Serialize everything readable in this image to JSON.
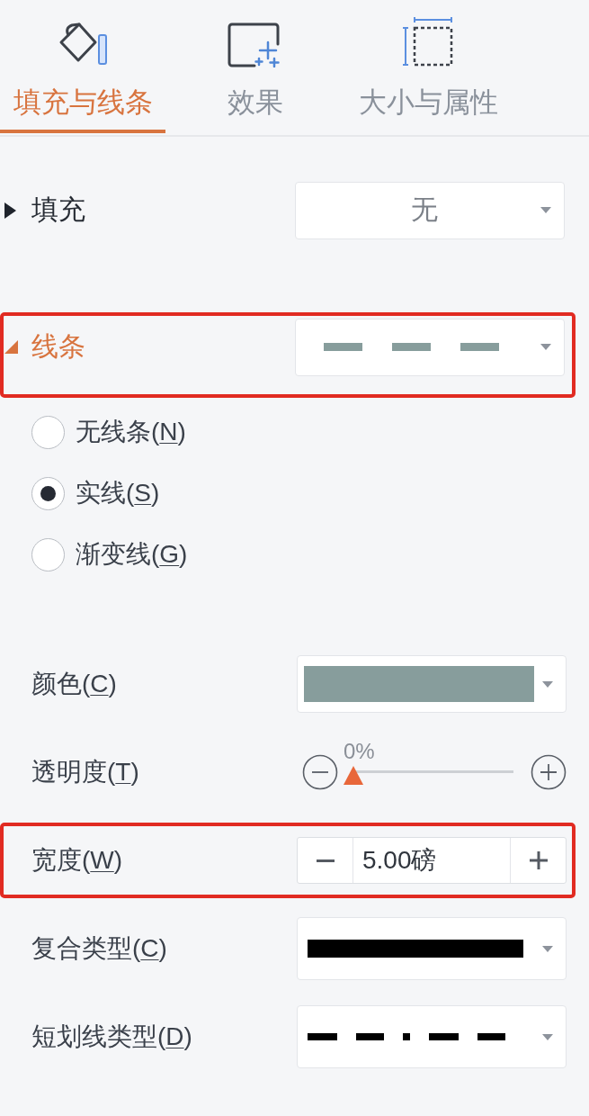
{
  "tabs": [
    {
      "label": "填充与线条",
      "selected": true
    },
    {
      "label": "效果",
      "selected": false
    },
    {
      "label": "大小与属性",
      "selected": false
    }
  ],
  "fill": {
    "title": "填充",
    "expanded": false,
    "highlighted": false,
    "dropdown": {
      "kind": "text",
      "value": "无"
    }
  },
  "line": {
    "title": "线条",
    "expanded": true,
    "highlighted": true,
    "dropdown": {
      "kind": "dashed-line"
    },
    "types": [
      {
        "label": "无线条(N)",
        "selected": false
      },
      {
        "label": "实线(S)",
        "selected": true
      },
      {
        "label": "渐变线(G)",
        "selected": false
      }
    ],
    "properties": [
      {
        "kind": "color",
        "label": "颜色(C)",
        "highlighted": false,
        "color": "#879d9c"
      },
      {
        "kind": "slider",
        "label": "透明度(T)",
        "highlighted": false,
        "reading": "0%",
        "level": 0
      },
      {
        "kind": "spinner",
        "label": "宽度(W)",
        "highlighted": true,
        "value": "5.00磅"
      },
      {
        "kind": "solid-line",
        "label": "复合类型(C)",
        "highlighted": false
      },
      {
        "kind": "dash-dot-line",
        "label": "短划线类型(D)",
        "highlighted": false
      }
    ]
  }
}
